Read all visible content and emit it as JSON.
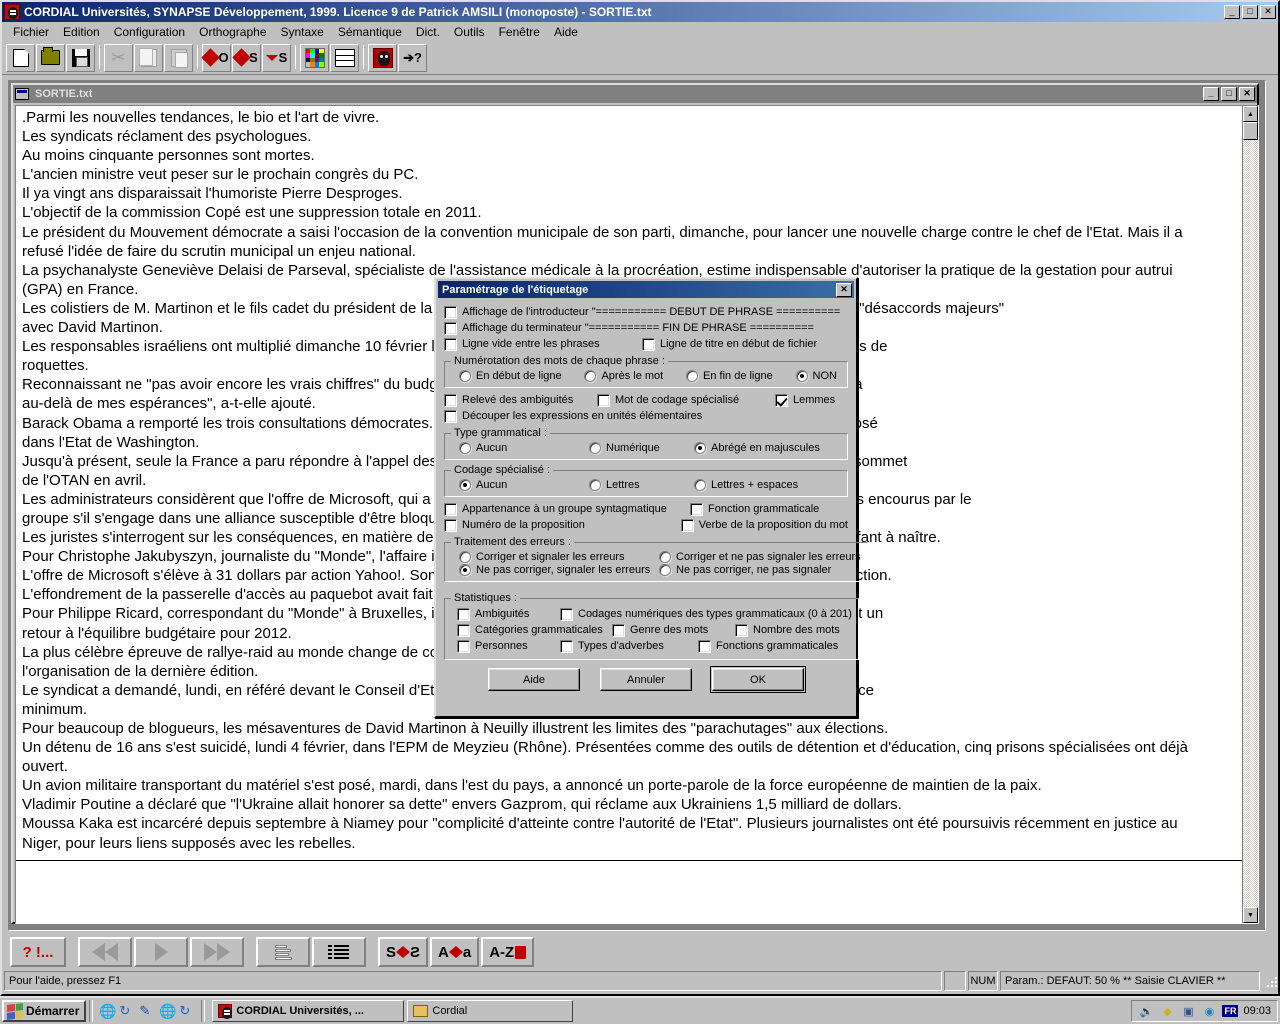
{
  "window": {
    "title": "CORDIAL Universités, SYNAPSE Développement, 1999. Licence 9 de Patrick AMSILI (monoposte) - SORTIE.txt",
    "minimize": "_",
    "maximize": "□",
    "close": "✕"
  },
  "menu": {
    "items": [
      "Fichier",
      "Edition",
      "Configuration",
      "Orthographe",
      "Syntaxe",
      "Sémantique",
      "Dict.",
      "Outils",
      "Fenêtre",
      "Aide"
    ]
  },
  "toolbar": {
    "buttons": [
      {
        "name": "new-document-icon",
        "label": ""
      },
      {
        "name": "open-folder-icon",
        "label": ""
      },
      {
        "name": "save-disk-icon",
        "label": ""
      },
      {
        "name": "cut-scissors-icon",
        "label": ""
      },
      {
        "name": "copy-icon",
        "label": ""
      },
      {
        "name": "paste-icon",
        "label": ""
      },
      {
        "name": "diamond-o-icon",
        "label": "O"
      },
      {
        "name": "diamond-s-icon",
        "label": "S"
      },
      {
        "name": "triangle-s-icon",
        "label": "S"
      },
      {
        "name": "color-palette-icon",
        "label": ""
      },
      {
        "name": "lines-icon",
        "label": ""
      },
      {
        "name": "mask-icon",
        "label": ""
      },
      {
        "name": "help-pointer-icon",
        "label": "?"
      }
    ]
  },
  "child_window": {
    "title": "SORTIE.txt",
    "minimize": "_",
    "maximize": "□",
    "close": "✕"
  },
  "document": {
    "lines": [
      ".Parmi les nouvelles tendances, le bio et l'art de vivre.",
      "Les syndicats réclament des psychologues.",
      "Au moins cinquante personnes sont mortes.",
      "L'ancien ministre veut peser sur le prochain congrès du PC.",
      "Il ya vingt ans disparaissait l'humoriste Pierre Desproges.",
      "L'objectif de la commission Copé est une suppression totale en 2011.",
      "Le président du Mouvement démocrate a saisi l'occasion de la convention municipale de son parti, dimanche, pour lancer une nouvelle charge contre le chef de l'Etat. Mais il a",
      "refusé l'idée de faire du scrutin municipal un enjeu national.",
      "La psychanalyste Geneviève Delaisi de Parseval, spécialiste de l'assistance médicale à la procréation, estime indispensable d'autoriser la pratique de la gestation pour autrui",
      "(GPA) en France.",
      "Les colistiers de M. Martinon et le fils cadet du président de la République ont annoncé leur propre liste à Neuilly en raison de \"désaccords majeurs\"",
      "avec  David Martinon.",
      "Les responsables israéliens ont multiplié dimanche 10 février les raids aériens dans la bande de Gaza en représailles à des tirs de",
      "roquettes.",
      "Reconnaissant ne \"pas avoir encore les vrais chiffres\" du budget, Mme Boutin s'est dite \"hypercontente, très sereine\". \"Cela va",
      "au-delà de mes espérances\", a-t-elle ajouté.",
      "Barack Obama a remporté les trois consultations démocrates. Battu au Kansas et en Louisiane par Huckabee, mais s'est imposé",
      "dans l'Etat de Washington.",
      "Jusqu'à présent, seule la France a paru répondre à l'appel des Etats-Unis. M. Sarkozy pourrait les annoncer lors du prochain sommet",
      "de l'OTAN en avril.",
      "Les administrateurs considèrent que l'offre de Microsoft, qui a été rejetée, est insuffisant et ne prend pas en compte les risques encourus par le",
      "groupe s'il s'engage dans une alliance susceptible d'être bloquée par les autorités.",
      "Les juristes s'interrogent sur les conséquences, en matière de droit, de ne pas reconnaître pas de personnalité juridique à l'enfant à naître.",
      "Pour Christophe Jakubyszyn, journaliste du \"Monde\", l'affaire illustre les \"ambiguïtés\" de Nicolas Sarkozy\".",
      "L'offre de Microsoft s'élève à 31 dollars par action Yahoo!. Son conseil refuse d'accepter une offre inférieure à 40 dollars par action.",
      "L'effondrement de la passerelle d'accès au paquebot avait fait quinze blessés.",
      "Pour Philippe Ricard, correspondant du \"Monde\" à Bruxelles, il s'agit d'une \"recommandation de l'Eurogroupe\" car ils prévoient un",
      "retour à l'équilibre budgétaire pour 2012.",
      "La plus célèbre épreuve de rallye-raid au monde change de continent après des menaces d'attentats qui ont plané sur",
      "l'organisation de la dernière édition.",
      "Le syndicat a demandé, lundi, en référé devant le Conseil d'Etat, la suspension par la RATP dans le cadre de la loi sur le service",
      "minimum.",
      "Pour beaucoup de blogueurs, les mésaventures de David Martinon à Neuilly illustrent les limites des \"parachutages\" aux élections.",
      "Un détenu de 16 ans s'est suicidé, lundi 4 février, dans l'EPM de Meyzieu (Rhône). Présentées comme des outils de détention et d'éducation, cinq prisons spécialisées ont déjà",
      "ouvert.",
      "Un avion militaire transportant du matériel s'est posé, mardi, dans l'est du pays, a annoncé un porte-parole de la force européenne de maintien de la paix.",
      "Vladimir Poutine a déclaré que \"l'Ukraine allait honorer sa dette\" envers Gazprom, qui réclame aux Ukrainiens 1,5 milliard de dollars.",
      "Moussa Kaka est incarcéré depuis septembre à Niamey pour \"complicité d'atteinte contre l'autorité de l'Etat\". Plusieurs journalistes ont été poursuivis récemment en justice au",
      "Niger, pour leurs liens supposés avec les rebelles."
    ]
  },
  "bottom_toolbar": {
    "buttons": [
      {
        "name": "errors-button",
        "label": "? !..."
      },
      {
        "name": "prev-fast-button",
        "label": ""
      },
      {
        "name": "play-button",
        "label": ""
      },
      {
        "name": "next-fast-button",
        "label": ""
      },
      {
        "name": "paragraph-button",
        "label": ""
      },
      {
        "name": "indent-button",
        "label": ""
      },
      {
        "name": "sentence-swap-button",
        "label": "S",
        "label2": "S"
      },
      {
        "name": "word-swap-button",
        "label": "A",
        "label2": "a"
      },
      {
        "name": "dictionary-button",
        "label": "A-Z"
      }
    ]
  },
  "statusbar": {
    "hint": "Pour l'aide, pressez F1",
    "num": "NUM",
    "param": "Param.: DEFAUT: 50 % ** Saisie CLAVIER **"
  },
  "dialog": {
    "title": "Paramétrage de l'étiquetage",
    "close": "✕",
    "top_checkboxes": [
      {
        "name": "show-introducer",
        "label": "Affichage de l'introducteur \"=========== DEBUT DE PHRASE ==========",
        "checked": false
      },
      {
        "name": "show-terminator",
        "label": "Affichage du terminateur \"=========== FIN DE PHRASE ==========",
        "checked": false
      }
    ],
    "row_checkboxes": [
      {
        "name": "blank-line-between-sentences",
        "label": "Ligne vide entre les phrases",
        "checked": false
      },
      {
        "name": "title-line-at-file-start",
        "label": "Ligne de titre en début de fichier",
        "checked": false
      }
    ],
    "numbering": {
      "legend": "Numérotation des mots de chaque phrase :",
      "options": [
        {
          "name": "numbering-line-start",
          "label": "En début de ligne",
          "checked": false
        },
        {
          "name": "numbering-after-word",
          "label": "Après le mot",
          "checked": false
        },
        {
          "name": "numbering-line-end",
          "label": "En fin de ligne",
          "checked": false
        },
        {
          "name": "numbering-none",
          "label": "NON",
          "checked": true
        }
      ]
    },
    "mid_checkboxes_row1": [
      {
        "name": "ambiguity-report",
        "label": "Relevé des ambiguités",
        "checked": false
      },
      {
        "name": "specialized-coding-word",
        "label": "Mot de codage spécialisé",
        "checked": false
      },
      {
        "name": "lemmas",
        "label": "Lemmes",
        "checked": true
      }
    ],
    "mid_checkboxes_row2": [
      {
        "name": "split-expressions",
        "label": "Découper les expressions en unités élémentaires",
        "checked": false
      }
    ],
    "grammatical_type": {
      "legend": "Type grammatical :",
      "options": [
        {
          "name": "gramtype-none",
          "label": "Aucun",
          "checked": false
        },
        {
          "name": "gramtype-numeric",
          "label": "Numérique",
          "checked": false
        },
        {
          "name": "gramtype-abbrev-caps",
          "label": "Abrégé en majuscules",
          "checked": true
        }
      ]
    },
    "specialized_coding": {
      "legend": "Codage spécialisé :",
      "options": [
        {
          "name": "coding-none",
          "label": "Aucun",
          "checked": true
        },
        {
          "name": "coding-letters",
          "label": "Lettres",
          "checked": false
        },
        {
          "name": "coding-letters-spaces",
          "label": "Lettres + espaces",
          "checked": false
        }
      ]
    },
    "syntagm_checkboxes": [
      {
        "name": "syntagm-group-membership",
        "label": "Appartenance à un groupe syntagmatique",
        "checked": false
      },
      {
        "name": "grammatical-function",
        "label": "Fonction grammaticale",
        "checked": false
      },
      {
        "name": "proposition-number",
        "label": "Numéro de la proposition",
        "checked": false
      },
      {
        "name": "proposition-verb-of-word",
        "label": "Verbe de la proposition du mot",
        "checked": false
      }
    ],
    "error_handling": {
      "legend": "Traitement des erreurs :",
      "options": [
        {
          "name": "errors-correct-report",
          "label": "Corriger et signaler les erreurs",
          "checked": false
        },
        {
          "name": "errors-correct-no-report",
          "label": "Corriger et ne pas signaler les erreurs",
          "checked": false
        },
        {
          "name": "errors-no-correct-report",
          "label": "Ne pas corriger, signaler les erreurs",
          "checked": true
        },
        {
          "name": "errors-no-correct-no-report",
          "label": "Ne pas corriger, ne pas signaler",
          "checked": false
        }
      ]
    },
    "statistics": {
      "legend": "Statistiques :",
      "options": [
        {
          "name": "stat-ambiguities",
          "label": "Ambiguités",
          "checked": false
        },
        {
          "name": "stat-numeric-codings",
          "label": "Codages numériques des types grammaticaux (0 à 201)",
          "checked": false
        },
        {
          "name": "stat-grammatical-categories",
          "label": "Catégories grammaticales",
          "checked": false
        },
        {
          "name": "stat-word-gender",
          "label": "Genre des mots",
          "checked": false
        },
        {
          "name": "stat-word-number",
          "label": "Nombre des mots",
          "checked": false
        },
        {
          "name": "stat-persons",
          "label": "Personnes",
          "checked": false
        },
        {
          "name": "stat-adverb-types",
          "label": "Types d'adverbes",
          "checked": false
        },
        {
          "name": "stat-grammatical-functions",
          "label": "Fonctions grammaticales",
          "checked": false
        }
      ]
    },
    "buttons": {
      "help": "Aide",
      "cancel": "Annuler",
      "ok": "OK"
    }
  },
  "taskbar": {
    "start": "Démarrer",
    "tasks": [
      {
        "name": "taskbar-item-cordial",
        "label": "CORDIAL Universités, ...",
        "active": true
      },
      {
        "name": "taskbar-item-cordial-folder",
        "label": "Cordial",
        "active": false
      }
    ],
    "tray": {
      "language": "FR",
      "clock": "09:03"
    }
  },
  "colors": {
    "desktop": "#008080",
    "window_face": "#c0c0c0",
    "title_active": "#0a246a",
    "title_inactive": "#808080",
    "accent_red": "#c00000"
  }
}
